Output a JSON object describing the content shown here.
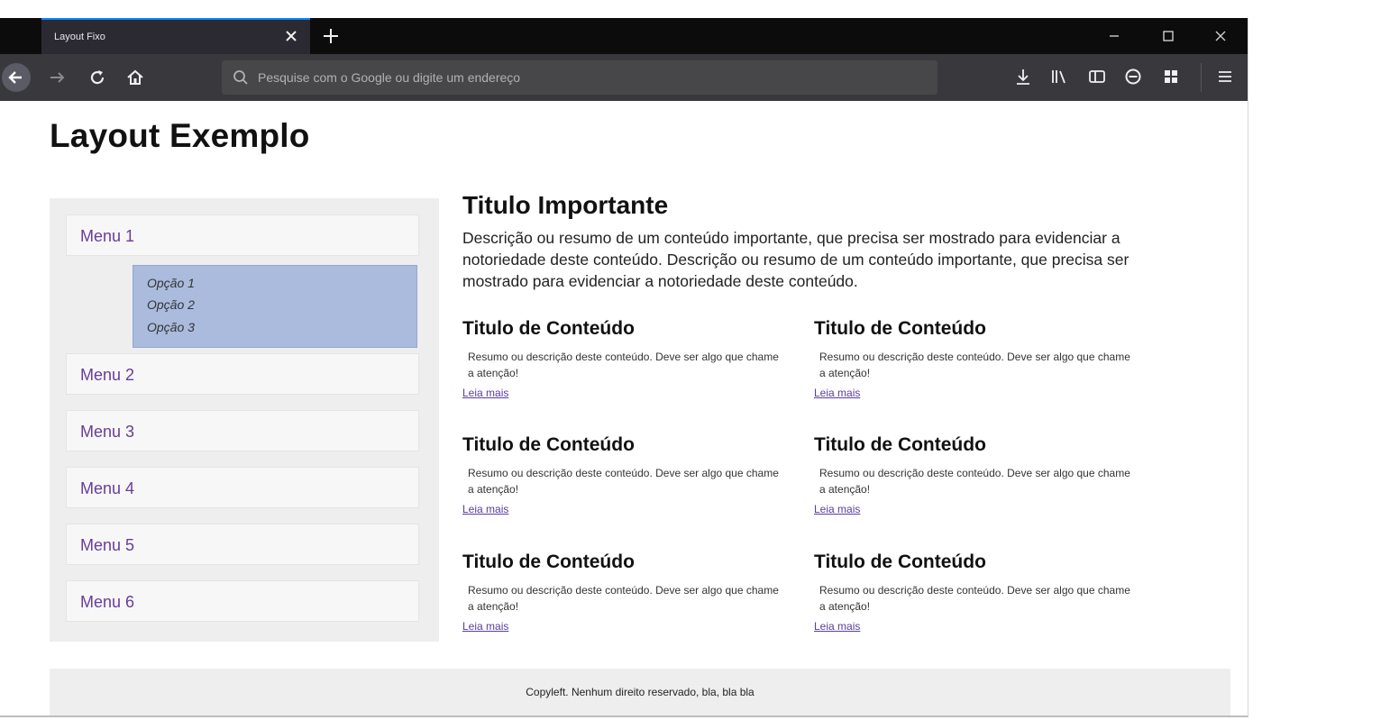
{
  "browser": {
    "tab_title": "Layout Fixo",
    "address_placeholder": "Pesquise com o Google ou digite um endereço"
  },
  "page": {
    "title": "Layout Exemplo",
    "sidebar": {
      "menus": [
        {
          "label": "Menu 1"
        },
        {
          "label": "Menu 2"
        },
        {
          "label": "Menu 3"
        },
        {
          "label": "Menu 4"
        },
        {
          "label": "Menu 5"
        },
        {
          "label": "Menu 6"
        }
      ],
      "submenu": [
        "Opção 1",
        "Opção 2",
        "Opção 3"
      ]
    },
    "main": {
      "title": "Titulo Importante",
      "description": "Descrição ou resumo de um conteúdo importante, que precisa ser mostrado para evidenciar a notoriedade deste conteúdo. Descrição ou resumo de um conteúdo importante, que precisa ser mostrado para evidenciar a notoriedade deste conteúdo."
    },
    "cards": [
      {
        "title": "Titulo de Conteúdo",
        "description": "Resumo ou descrição deste conteúdo. Deve ser algo que chame a atenção!",
        "link": "Leia mais"
      },
      {
        "title": "Titulo de Conteúdo",
        "description": "Resumo ou descrição deste conteúdo. Deve ser algo que chame a atenção!",
        "link": "Leia mais"
      },
      {
        "title": "Titulo de Conteúdo",
        "description": "Resumo ou descrição deste conteúdo. Deve ser algo que chame a atenção!",
        "link": "Leia mais"
      },
      {
        "title": "Titulo de Conteúdo",
        "description": "Resumo ou descrição deste conteúdo. Deve ser algo que chame a atenção!",
        "link": "Leia mais"
      },
      {
        "title": "Titulo de Conteúdo",
        "description": "Resumo ou descrição deste conteúdo. Deve ser algo que chame a atenção!",
        "link": "Leia mais"
      },
      {
        "title": "Titulo de Conteúdo",
        "description": "Resumo ou descrição deste conteúdo. Deve ser algo que chame a atenção!",
        "link": "Leia mais"
      }
    ],
    "footer": "Copyleft. Nenhum direito reservado, bla, bla bla"
  },
  "colors": {
    "tabbar": "#0c0c0d",
    "navbar": "#38383d",
    "tab_accent": "#0a84ff",
    "menu_text": "#6a3c99",
    "submenu_bg": "#aabbde",
    "panel_bg": "#eeeeee"
  },
  "icons": {
    "tab_close": "close-icon",
    "new_tab": "plus-icon",
    "back": "arrow-left-icon",
    "forward": "arrow-right-icon",
    "reload": "reload-icon",
    "home": "home-icon",
    "search": "search-icon",
    "download": "download-icon",
    "library": "library-icon",
    "sidebar": "sidebar-icon",
    "account": "account-icon",
    "extensions": "extensions-icon",
    "menu": "hamburger-menu-icon"
  }
}
